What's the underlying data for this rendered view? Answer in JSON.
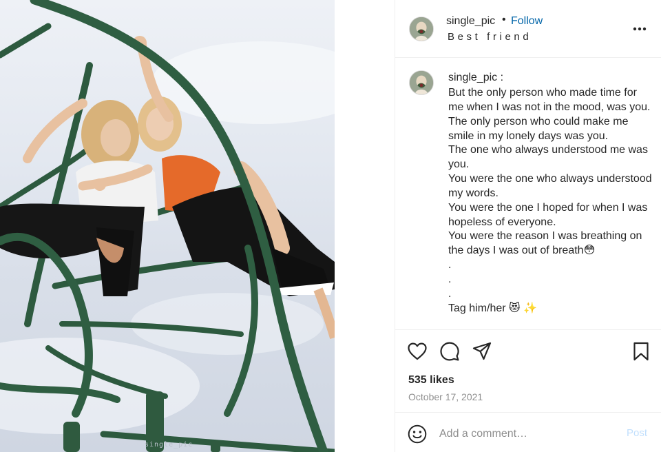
{
  "post": {
    "watermark": "single_pic",
    "photo_alt": "Two women sitting on a green climbing frame against a cloudy sky"
  },
  "header": {
    "username": "single_pic",
    "separator": "•",
    "follow_label": "Follow",
    "subtitle": "Best friend",
    "more_icon": "more-horizontal-icon"
  },
  "caption": {
    "username": "single_pic :",
    "text": "But the only person who made time for me when I was not in the mood, was you.\nThe only person who could make me smile in my lonely days was you.\nThe one who always understood me was you.\nYou were the one who always understood my words.\nYou were the one I hoped for when I was hopeless of everyone.\nYou were the reason I was breathing on the days I was out of breath😳\n.\n.\n.\nTag him/her 😻 ✨"
  },
  "actions": {
    "like_icon": "heart-icon",
    "comment_icon": "comment-icon",
    "share_icon": "send-icon",
    "save_icon": "bookmark-icon",
    "likes": "535 likes",
    "date": "October 17, 2021"
  },
  "comment_bar": {
    "emoji_icon": "smiley-icon",
    "placeholder": "Add a comment…",
    "post_label": "Post"
  },
  "colors": {
    "link_blue": "#0064a8",
    "post_disabled": "#c0dffd",
    "muted_text": "#8e8e8e",
    "border": "#efefef",
    "frame_green": "#2f5a3f"
  }
}
